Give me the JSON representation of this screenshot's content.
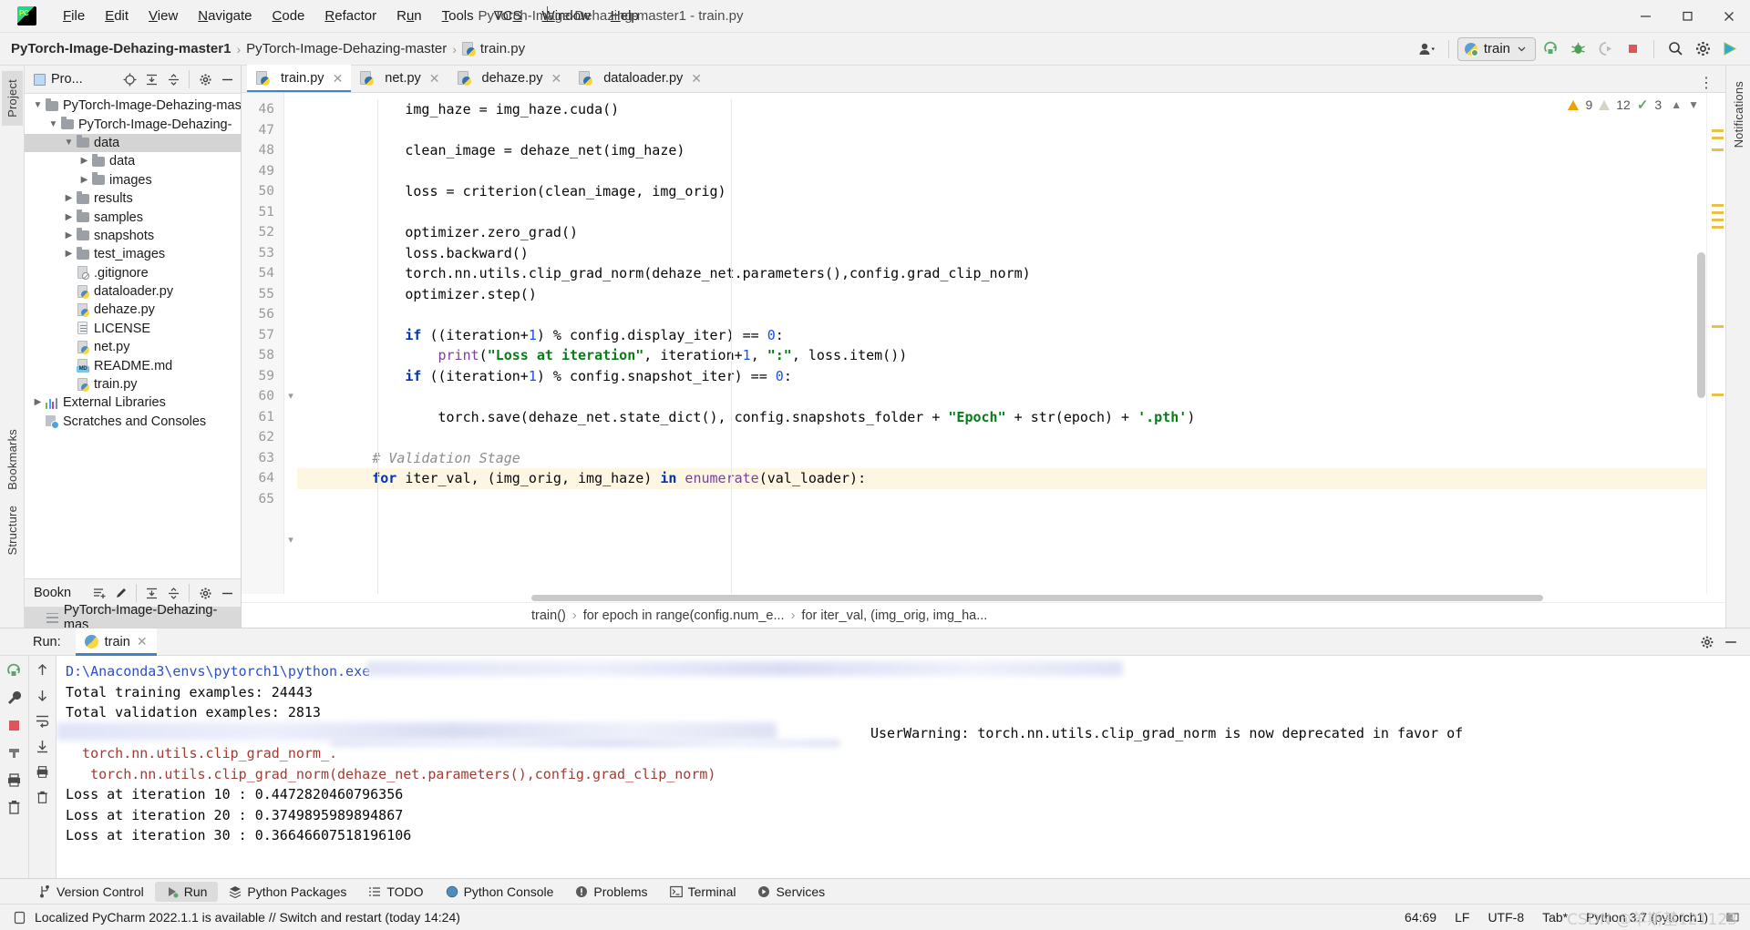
{
  "window": {
    "title": "PyTorch-Image-Dehazing-master1 - train.py",
    "minimize": "–",
    "maximize": "❐",
    "close": "✕"
  },
  "menu": {
    "items": [
      "File",
      "Edit",
      "View",
      "Navigate",
      "Code",
      "Refactor",
      "Run",
      "Tools",
      "VCS",
      "Window",
      "Help"
    ]
  },
  "navbar": {
    "breadcrumb": [
      "PyTorch-Image-Dehazing-master1",
      "PyTorch-Image-Dehazing-master",
      "train.py"
    ],
    "run_config": "train",
    "icons": [
      "user-avatar-icon",
      "rerun-icon",
      "debug-icon",
      "coverage-icon",
      "stop-icon",
      "search-everywhere-icon",
      "settings-icon",
      "updates-icon"
    ]
  },
  "project_panel": {
    "title": "Pro...",
    "tree": [
      {
        "depth": 0,
        "label": "PyTorch-Image-Dehazing-mas",
        "type": "folder",
        "arrow": "down",
        "selected": false
      },
      {
        "depth": 1,
        "label": "PyTorch-Image-Dehazing-",
        "type": "folder",
        "arrow": "down",
        "selected": false
      },
      {
        "depth": 2,
        "label": "data",
        "type": "folder",
        "arrow": "down",
        "selected": true
      },
      {
        "depth": 3,
        "label": "data",
        "type": "folder",
        "arrow": "right",
        "selected": false
      },
      {
        "depth": 3,
        "label": "images",
        "type": "folder",
        "arrow": "right",
        "selected": false
      },
      {
        "depth": 2,
        "label": "results",
        "type": "folder",
        "arrow": "right",
        "selected": false
      },
      {
        "depth": 2,
        "label": "samples",
        "type": "folder",
        "arrow": "right",
        "selected": false
      },
      {
        "depth": 2,
        "label": "snapshots",
        "type": "folder",
        "arrow": "right",
        "selected": false
      },
      {
        "depth": 2,
        "label": "test_images",
        "type": "folder",
        "arrow": "right",
        "selected": false
      },
      {
        "depth": 2,
        "label": ".gitignore",
        "type": "gitignore",
        "arrow": "",
        "selected": false
      },
      {
        "depth": 2,
        "label": "dataloader.py",
        "type": "python",
        "arrow": "",
        "selected": false
      },
      {
        "depth": 2,
        "label": "dehaze.py",
        "type": "python",
        "arrow": "",
        "selected": false
      },
      {
        "depth": 2,
        "label": "LICENSE",
        "type": "text",
        "arrow": "",
        "selected": false
      },
      {
        "depth": 2,
        "label": "net.py",
        "type": "python",
        "arrow": "",
        "selected": false
      },
      {
        "depth": 2,
        "label": "README.md",
        "type": "markdown",
        "arrow": "",
        "selected": false
      },
      {
        "depth": 2,
        "label": "train.py",
        "type": "python",
        "arrow": "",
        "selected": false
      },
      {
        "depth": 0,
        "label": "External Libraries",
        "type": "extlib",
        "arrow": "right",
        "selected": false
      },
      {
        "depth": 0,
        "label": "Scratches and Consoles",
        "type": "scratch",
        "arrow": "",
        "selected": false
      }
    ]
  },
  "bookmarks_panel": {
    "title": "Bookn",
    "item": "PyTorch-Image-Dehazing-mas"
  },
  "left_strip": {
    "tabs": [
      "Project",
      "Structure",
      "Bookmarks"
    ]
  },
  "right_strip": {
    "tabs": [
      "Notifications"
    ]
  },
  "editor": {
    "tabs": [
      {
        "label": "train.py",
        "active": true
      },
      {
        "label": "net.py",
        "active": false
      },
      {
        "label": "dehaze.py",
        "active": false
      },
      {
        "label": "dataloader.py",
        "active": false
      }
    ],
    "inspections": {
      "warnings": "9",
      "weak_warnings": "12",
      "typos": "3"
    },
    "first_line_number": 46,
    "lines": [
      {
        "n": 46,
        "html": "            img_haze = img_haze.cuda()",
        "hl": false
      },
      {
        "n": 47,
        "html": "",
        "hl": false
      },
      {
        "n": 48,
        "html": "            clean_image = dehaze_net(img_haze)",
        "hl": false
      },
      {
        "n": 49,
        "html": "",
        "hl": false
      },
      {
        "n": 50,
        "html": "            loss = criterion(clean_image, img_orig)",
        "hl": false
      },
      {
        "n": 51,
        "html": "",
        "hl": false
      },
      {
        "n": 52,
        "html": "            optimizer.zero_grad()",
        "hl": false
      },
      {
        "n": 53,
        "html": "            loss.backward()",
        "hl": false
      },
      {
        "n": 54,
        "html": "            torch.nn.utils.clip_grad_norm(dehaze_net.parameters(),config.grad_clip_norm)",
        "hl": false
      },
      {
        "n": 55,
        "html": "            optimizer.step()",
        "hl": false
      },
      {
        "n": 56,
        "html": "",
        "hl": false
      },
      {
        "n": 57,
        "html": "            <k>if</k> ((iteration+<n>1</n>) % config.display_iter) == <n>0</n>:",
        "hl": false
      },
      {
        "n": 58,
        "html": "                <f>print</f>(<s>\"Loss at iteration\"</s>, iteration+<n>1</n>, <s>\":\"</s>, loss.item())",
        "hl": false
      },
      {
        "n": 59,
        "html": "            <k>if</k> ((iteration+<n>1</n>) % config.snapshot_iter) == <n>0</n>:",
        "hl": false
      },
      {
        "n": 60,
        "html": "",
        "hl": false
      },
      {
        "n": 61,
        "html": "                torch.save(dehaze_net.state_dict(), config.snapshots_folder + <s>\"Epoch\"</s> + str(epoch) + <s>'.pth'</s>)",
        "hl": false
      },
      {
        "n": 62,
        "html": "",
        "hl": false
      },
      {
        "n": 63,
        "html": "        <c># Validation Stage</c>",
        "hl": false
      },
      {
        "n": 64,
        "html": "        <k>for</k> iter_val, (img_orig, img_haze) <k>in</k> <f>enumerate</f>(val_loader):",
        "hl": true
      },
      {
        "n": 65,
        "html": "",
        "hl": false
      }
    ],
    "breadcrumbs": [
      "train()",
      "for epoch in range(config.num_e...",
      "for iter_val, (img_orig, img_ha..."
    ]
  },
  "run_panel": {
    "label": "Run:",
    "tab": "train",
    "console_lines": [
      {
        "text": "D:\\Anaconda3\\envs\\pytorch1\\python.exe ",
        "style": "link",
        "blur_after": true
      },
      {
        "text": "Total training examples: 24443",
        "style": "normal"
      },
      {
        "text": "Total validation examples: 2813",
        "style": "normal"
      },
      {
        "text": "",
        "style": "blurred",
        "suffix": "UserWarning: torch.nn.utils.clip_grad_norm is now deprecated in favor of",
        "suffix_style": "err"
      },
      {
        "text": "  torch.nn.utils.clip_grad_norm_.",
        "style": "err"
      },
      {
        "text": "   torch.nn.utils.clip_grad_norm(dehaze_net.parameters(),config.grad_clip_norm)",
        "style": "err"
      },
      {
        "text": "Loss at iteration 10 : 0.4472820460796356",
        "style": "normal"
      },
      {
        "text": "Loss at iteration 20 : 0.3749895989894867",
        "style": "normal"
      },
      {
        "text": "Loss at iteration 30 : 0.36646607518196106",
        "style": "normal"
      }
    ],
    "gutter_icons": [
      "rerun-icon",
      "settings-wrench-icon",
      "stop-icon",
      "trash-icon"
    ],
    "gutter2_icons": [
      "scroll-up-icon",
      "scroll-down-icon",
      "soft-wrap-icon",
      "scroll-end-icon",
      "print-icon",
      "clear-all-icon"
    ]
  },
  "tool_window_bar": {
    "items": [
      {
        "label": "Version Control",
        "icon": "branch-icon",
        "active": false
      },
      {
        "label": "Run",
        "icon": "run-icon",
        "active": true
      },
      {
        "label": "Python Packages",
        "icon": "packages-icon",
        "active": false
      },
      {
        "label": "TODO",
        "icon": "todo-icon",
        "active": false
      },
      {
        "label": "Python Console",
        "icon": "python-icon",
        "active": false
      },
      {
        "label": "Problems",
        "icon": "problems-icon",
        "active": false
      },
      {
        "label": "Terminal",
        "icon": "terminal-icon",
        "active": false
      },
      {
        "label": "Services",
        "icon": "services-icon",
        "active": false
      }
    ]
  },
  "status_bar": {
    "message": "Localized PyCharm 2022.1.1 is available // Switch and restart (today 14:24)",
    "caret_position": "64:69",
    "line_separator": "LF",
    "encoding": "UTF-8",
    "indent": "Tab*",
    "interpreter": "Python 3.7 (pytorch1)",
    "watermark": "CSDN @羊斯基121123"
  },
  "colors": {
    "accent": "#4083c9",
    "keyword": "#0033b3",
    "string": "#067d17",
    "number": "#1750eb",
    "comment": "#8c8c8c",
    "error": "#a33b32",
    "link": "#2b50c8",
    "highlight_line": "#fdf6e3"
  }
}
